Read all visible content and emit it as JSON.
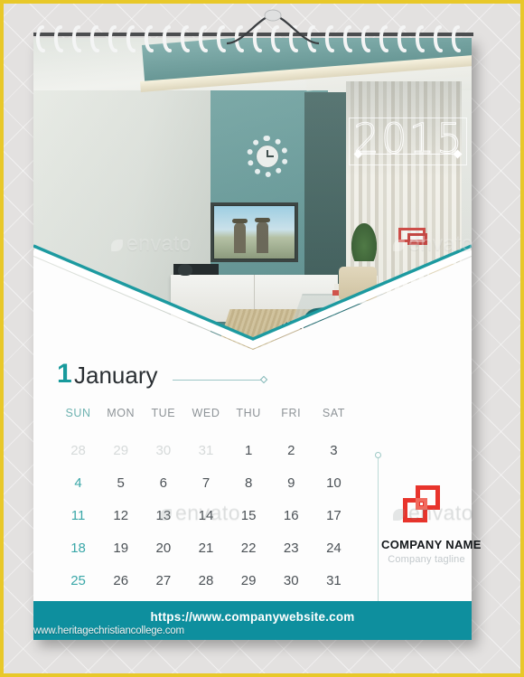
{
  "page": {
    "border_color": "#e8c829",
    "backdrop_color": "#e3e1e0",
    "sheet_color": "#fdfdfd",
    "accent_teal": "#0e8f9e",
    "logo_red": "#e8342c"
  },
  "hanger": {
    "icon": "calendar-hanger-hook"
  },
  "binding": {
    "icon": "spiral-wire-binding",
    "loops": 24
  },
  "photo": {
    "alt": "modern bedroom interior with teal accent wall, wall clock, flat-screen tv, white sideboard, armchairs and teal bed throw",
    "year_badge": {
      "label": "2015"
    }
  },
  "month": {
    "number": "1",
    "name": "January"
  },
  "calendar": {
    "weekday_headers": [
      "SUN",
      "MON",
      "TUE",
      "WED",
      "THU",
      "FRI",
      "SAT"
    ],
    "weeks": [
      [
        {
          "day": "28",
          "muted": true
        },
        {
          "day": "29",
          "muted": true
        },
        {
          "day": "30",
          "muted": true
        },
        {
          "day": "31",
          "muted": true
        },
        {
          "day": "1",
          "muted": false
        },
        {
          "day": "2",
          "muted": false
        },
        {
          "day": "3",
          "muted": false
        }
      ],
      [
        {
          "day": "4",
          "muted": false
        },
        {
          "day": "5",
          "muted": false
        },
        {
          "day": "6",
          "muted": false
        },
        {
          "day": "7",
          "muted": false
        },
        {
          "day": "8",
          "muted": false
        },
        {
          "day": "9",
          "muted": false
        },
        {
          "day": "10",
          "muted": false
        }
      ],
      [
        {
          "day": "11",
          "muted": false
        },
        {
          "day": "12",
          "muted": false
        },
        {
          "day": "13",
          "muted": false
        },
        {
          "day": "14",
          "muted": false
        },
        {
          "day": "15",
          "muted": false
        },
        {
          "day": "16",
          "muted": false
        },
        {
          "day": "17",
          "muted": false
        }
      ],
      [
        {
          "day": "18",
          "muted": false
        },
        {
          "day": "19",
          "muted": false
        },
        {
          "day": "20",
          "muted": false
        },
        {
          "day": "21",
          "muted": false
        },
        {
          "day": "22",
          "muted": false
        },
        {
          "day": "23",
          "muted": false
        },
        {
          "day": "24",
          "muted": false
        }
      ],
      [
        {
          "day": "25",
          "muted": false
        },
        {
          "day": "26",
          "muted": false
        },
        {
          "day": "27",
          "muted": false
        },
        {
          "day": "28",
          "muted": false
        },
        {
          "day": "29",
          "muted": false
        },
        {
          "day": "30",
          "muted": false
        },
        {
          "day": "31",
          "muted": false
        }
      ]
    ]
  },
  "brand": {
    "logo_icon": "overlapping-squares-logo",
    "name": "COMPANY NAME",
    "tagline": "Company tagline"
  },
  "footer": {
    "website": "https://www.companywebsite.com"
  },
  "watermarks": {
    "stock": "envato",
    "site": "www.heritagechristiancollege.com"
  }
}
